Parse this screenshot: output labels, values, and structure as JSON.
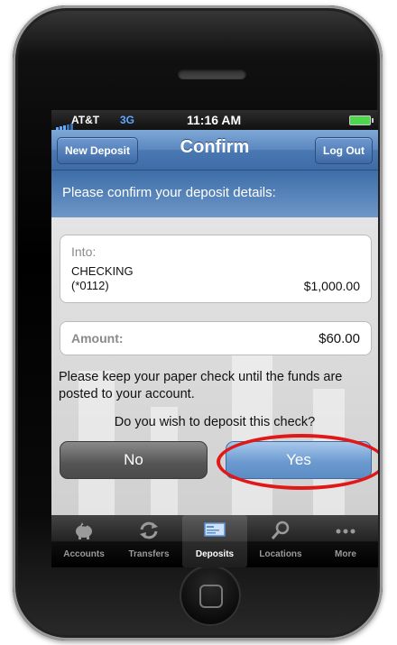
{
  "status_bar": {
    "carrier": "AT&T",
    "network": "3G",
    "time": "11:16 AM"
  },
  "nav_bar": {
    "left_button": "New Deposit",
    "title": "Confirm",
    "right_button": "Log Out"
  },
  "subtitle": "Please confirm your deposit details:",
  "into_card": {
    "label": "Into:",
    "account_name": "CHECKING",
    "account_number": "(*0112)",
    "balance": "$1,000.00"
  },
  "amount_card": {
    "label": "Amount:",
    "value": "$60.00"
  },
  "note": "Please keep your paper check until the funds are posted to your account.",
  "question": "Do you wish to deposit this check?",
  "buttons": {
    "no": "No",
    "yes": "Yes"
  },
  "tabs": [
    {
      "label": "Accounts",
      "icon": "piggy-bank-icon"
    },
    {
      "label": "Transfers",
      "icon": "transfer-arrows-icon"
    },
    {
      "label": "Deposits",
      "icon": "check-deposit-icon",
      "active": true
    },
    {
      "label": "Locations",
      "icon": "magnifier-icon"
    },
    {
      "label": "More",
      "icon": "more-dots-icon"
    }
  ],
  "colors": {
    "nav_blue": "#4a78b2",
    "highlight_red": "#e01818",
    "yes_blue": "#6c9ad0",
    "no_gray": "#555555"
  }
}
